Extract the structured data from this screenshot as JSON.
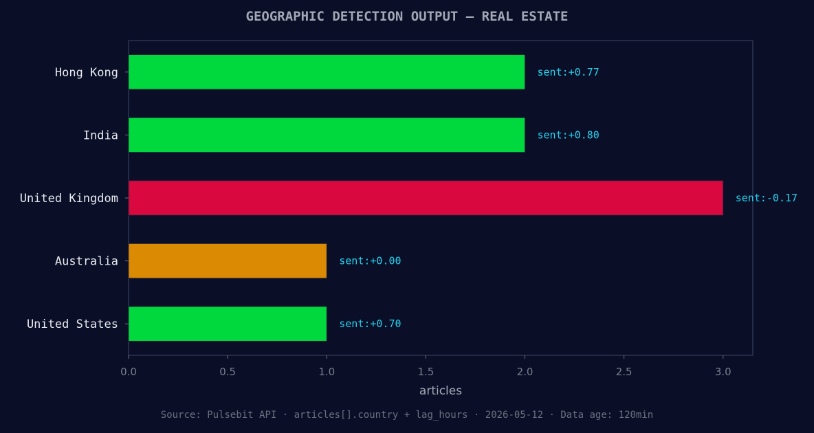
{
  "chart_data": {
    "type": "bar",
    "orientation": "horizontal",
    "title": "GEOGRAPHIC DETECTION OUTPUT — REAL ESTATE",
    "xlabel": "articles",
    "ylabel": "",
    "xlim": [
      0,
      3.15
    ],
    "xticks": [
      "0.0",
      "0.5",
      "1.0",
      "1.5",
      "2.0",
      "2.5",
      "3.0"
    ],
    "grid": false,
    "categories": [
      "Hong Kong",
      "India",
      "United Kingdom",
      "Australia",
      "United States"
    ],
    "values": [
      2,
      2,
      3,
      1,
      1
    ],
    "annotations": [
      "sent:+0.77",
      "sent:+0.80",
      "sent:-0.17",
      "sent:+0.00",
      "sent:+0.70"
    ],
    "bar_colors": [
      "#00d93e",
      "#00d93e",
      "#d9083e",
      "#db8a04",
      "#00d93e"
    ]
  },
  "footer": {
    "source": "Source: Pulsebit API · articles[].country + lag_hours · 2026-05-12 · Data age: 120min"
  },
  "colors": {
    "background": "#0a0e27",
    "axis": "#2e3350",
    "annotation": "#22d3ee"
  }
}
